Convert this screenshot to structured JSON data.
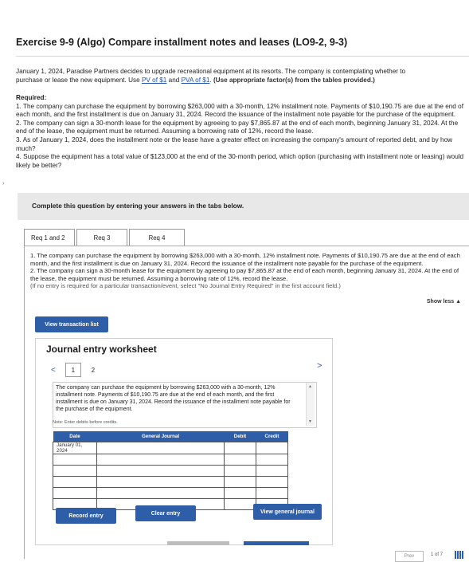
{
  "page": {
    "title": "Exercise 9-9 (Algo) Compare installment notes and leases (LO9-2, 9-3)"
  },
  "intro": {
    "text1": "January 1, 2024, Paradise Partners decides to upgrade recreational equipment at its resorts. The company is contemplating whether to",
    "text2": "purchase or lease the new equipment. Use ",
    "link_pv": "PV of $1",
    "and": " and ",
    "link_pva": "PVA of $1",
    "dot": ". ",
    "bold_note": "(Use appropriate factor(s) from the tables provided.)"
  },
  "required": {
    "heading": "Required:",
    "r1": "1. The company can purchase the equipment by borrowing $263,000 with a 30-month, 12% installment note. Payments of $10,190.75 are due at the end of each month, and the first installment is due on January 31, 2024. Record the issuance of the installment note payable for the purchase of the equipment.",
    "r2": "2. The company can sign a 30-month lease for the equipment by agreeing to pay $7,865.87 at the end of each month, beginning January 31, 2024. At the end of the lease, the equipment must be returned. Assuming a borrowing rate of 12%, record the lease.",
    "r3": "3. As of January 1, 2024, does the installment note or the lease have a greater effect on increasing the company's amount of reported debt, and by how much?",
    "r4": "4. Suppose the equipment has a total value of $123,000 at the end of the 30-month period, which option (purchasing with installment note or leasing) would likely be better?"
  },
  "complete_prompt": "Complete this question by entering your answers in the tabs below.",
  "tabs": [
    {
      "label": "Req 1 and 2"
    },
    {
      "label": "Req 3"
    },
    {
      "label": "Req 4"
    }
  ],
  "panel": {
    "p1": "1. The company can purchase the equipment by borrowing $263,000 with a 30-month, 12% installment note. Payments of $10,190.75 are due at the end of each month, and the first installment is due on January 31, 2024. Record the issuance of the installment note payable for the purchase of the equipment.",
    "p2": "2. The company can sign a 30-month lease for the equipment by agreeing to pay $7,865.87 at the end of each month, beginning January 31, 2024. At the end of the lease, the equipment must be returned. Assuming a borrowing rate of 12%, record the lease.",
    "hint": "(If no entry is required for a particular transaction/event, select \"No Journal Entry Required\" in the first account field.)",
    "show_less": "Show less ▲"
  },
  "buttons": {
    "view_tx": "View transaction list",
    "record": "Record entry",
    "clear": "Clear entry",
    "general_journal": "View general journal"
  },
  "worksheet": {
    "title": "Journal entry worksheet",
    "prev_chevron": "<",
    "next_chevron": ">",
    "pages": [
      "1",
      "2"
    ],
    "description": "The company can purchase the equipment by borrowing $263,000 with a 30-month, 12% installment note. Payments of $10,190.75 are due at the end of each month, and the first installment is due on January 31, 2024. Record the issuance of the installment note payable for the purchase of the equipment.",
    "note": "Note: Enter debits before credits.",
    "columns": [
      "Date",
      "General Journal",
      "Debit",
      "Credit"
    ],
    "rows": [
      {
        "date": "January 01, 2024",
        "account": "",
        "debit": "",
        "credit": ""
      },
      {
        "date": "",
        "account": "",
        "debit": "",
        "credit": ""
      },
      {
        "date": "",
        "account": "",
        "debit": "",
        "credit": ""
      },
      {
        "date": "",
        "account": "",
        "debit": "",
        "credit": ""
      },
      {
        "date": "",
        "account": "",
        "debit": "",
        "credit": ""
      },
      {
        "date": "",
        "account": "",
        "debit": "",
        "credit": ""
      }
    ]
  },
  "pager": {
    "prev": "Prev",
    "info": "1 of 7"
  }
}
